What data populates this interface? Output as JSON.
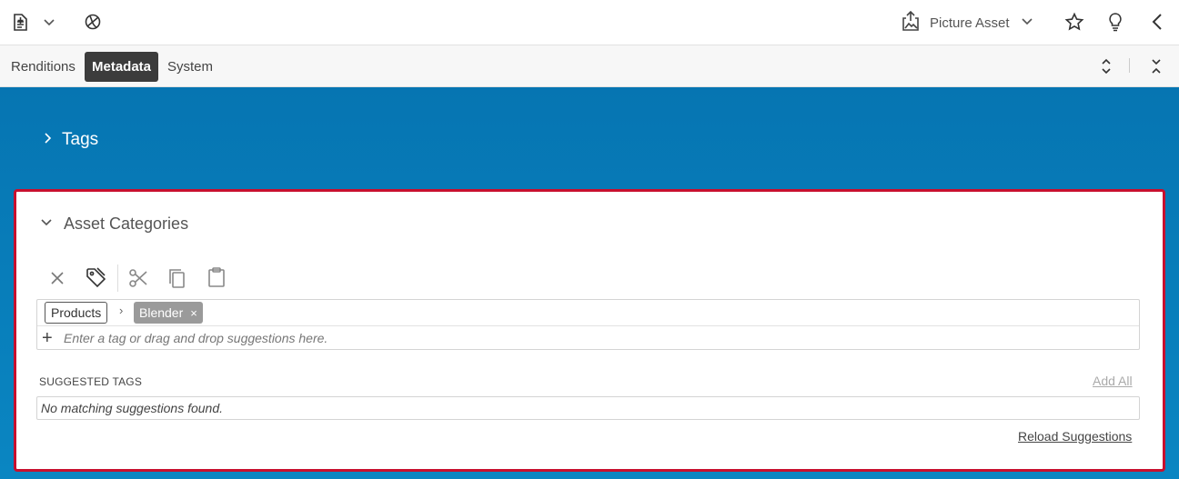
{
  "header": {
    "document_type": "Picture Asset",
    "icons": [
      "document-icon",
      "chevron-down-icon",
      "globe-icon",
      "upload-icon",
      "star-icon",
      "lightbulb-icon",
      "chevron-left-icon"
    ]
  },
  "tabs": [
    {
      "label": "Renditions",
      "active": false
    },
    {
      "label": "Metadata",
      "active": true
    },
    {
      "label": "System",
      "active": false
    }
  ],
  "tags_section": {
    "title": "Tags",
    "expanded": false
  },
  "asset_categories": {
    "title": "Asset Categories",
    "expanded": true,
    "toolbar_icons": [
      "close-icon",
      "tag-icon",
      "cut-icon",
      "copy-icon",
      "paste-icon"
    ],
    "path": [
      {
        "label": "Products"
      },
      {
        "label": "Blender",
        "remove": "×"
      }
    ],
    "path_separator": "›",
    "add_symbol": "+",
    "input_placeholder": "Enter a tag or drag and drop suggestions here.",
    "suggested_label": "SUGGESTED TAGS",
    "add_all_label": "Add All",
    "no_suggestions": "No matching suggestions found.",
    "reload_label": "Reload Suggestions"
  },
  "colors": {
    "panel_blue": "#0675b2",
    "highlight_border": "#c8102e",
    "active_tab": "#3c3c3c",
    "chip_grey": "#9a9a9a"
  }
}
